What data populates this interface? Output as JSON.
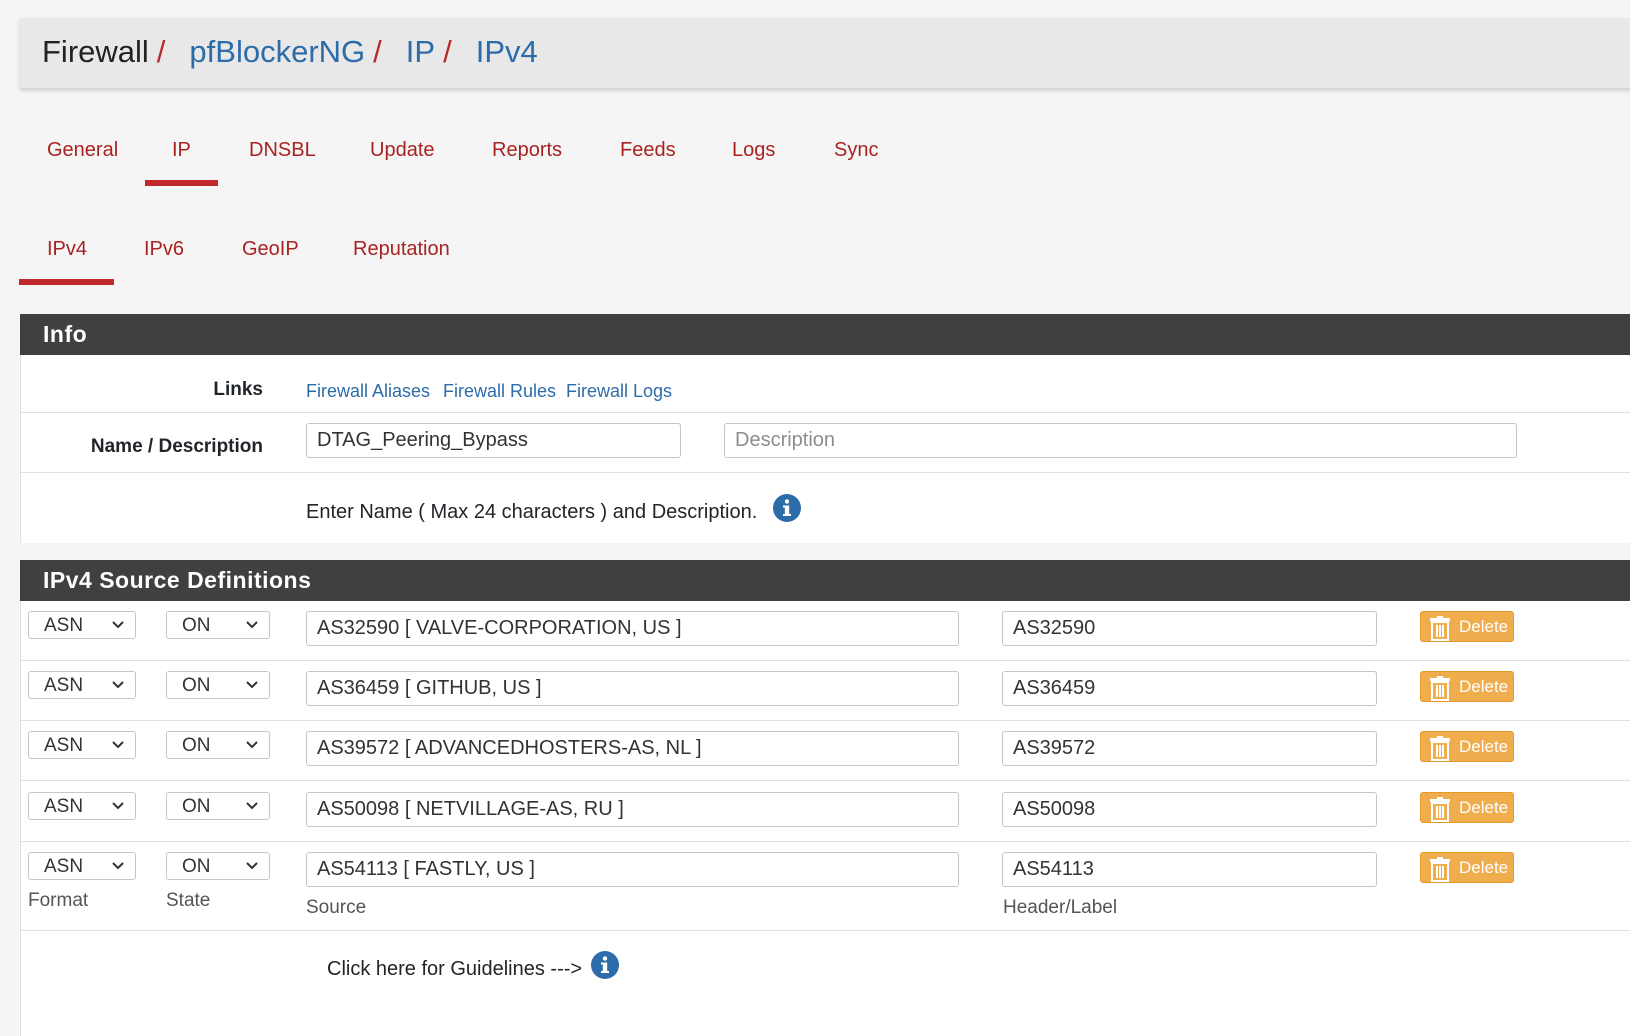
{
  "breadcrumb": {
    "items": [
      "Firewall",
      "pfBlockerNG",
      "IP",
      "IPv4"
    ],
    "separator": "/"
  },
  "tabs": [
    {
      "label": "General"
    },
    {
      "label": "IP",
      "active": true
    },
    {
      "label": "DNSBL"
    },
    {
      "label": "Update"
    },
    {
      "label": "Reports"
    },
    {
      "label": "Feeds"
    },
    {
      "label": "Logs"
    },
    {
      "label": "Sync"
    }
  ],
  "subtabs": [
    {
      "label": "IPv4",
      "active": true
    },
    {
      "label": "IPv6"
    },
    {
      "label": "GeoIP"
    },
    {
      "label": "Reputation"
    }
  ],
  "info_panel": {
    "title": "Info",
    "links_label": "Links",
    "links": [
      "Firewall Aliases",
      "Firewall Rules",
      "Firewall Logs"
    ],
    "name_desc_label": "Name / Description",
    "name_value": "DTAG_Peering_Bypass",
    "description_placeholder": "Description",
    "help_text": "Enter Name ( Max 24 characters ) and Description."
  },
  "source_panel": {
    "title": "IPv4 Source Definitions",
    "rows": [
      {
        "format": "ASN",
        "state": "ON",
        "source": "AS32590 [ VALVE-CORPORATION, US ]",
        "header": "AS32590",
        "delete_label": "Delete"
      },
      {
        "format": "ASN",
        "state": "ON",
        "source": "AS36459 [ GITHUB, US ]",
        "header": "AS36459",
        "delete_label": "Delete"
      },
      {
        "format": "ASN",
        "state": "ON",
        "source": "AS39572 [ ADVANCEDHOSTERS-AS, NL ]",
        "header": "AS39572",
        "delete_label": "Delete"
      },
      {
        "format": "ASN",
        "state": "ON",
        "source": "AS50098 [ NETVILLAGE-AS, RU ]",
        "header": "AS50098",
        "delete_label": "Delete"
      },
      {
        "format": "ASN",
        "state": "ON",
        "source": "AS54113 [ FASTLY, US ]",
        "header": "AS54113",
        "delete_label": "Delete"
      }
    ],
    "column_labels": {
      "format": "Format",
      "state": "State",
      "source": "Source",
      "header": "Header/Label"
    },
    "guidelines_text": "Click here for Guidelines --->"
  },
  "colors": {
    "tab_text": "#a82222",
    "tab_active_underline": "#c0282b",
    "link": "#2c6ca8",
    "panel_header": "#404040",
    "delete_button": "#f0ad4e",
    "info_icon": "#2c6ca8"
  },
  "icons": {
    "info": "info-circle-icon",
    "delete": "trash-icon",
    "select": "chevron-down-icon"
  }
}
